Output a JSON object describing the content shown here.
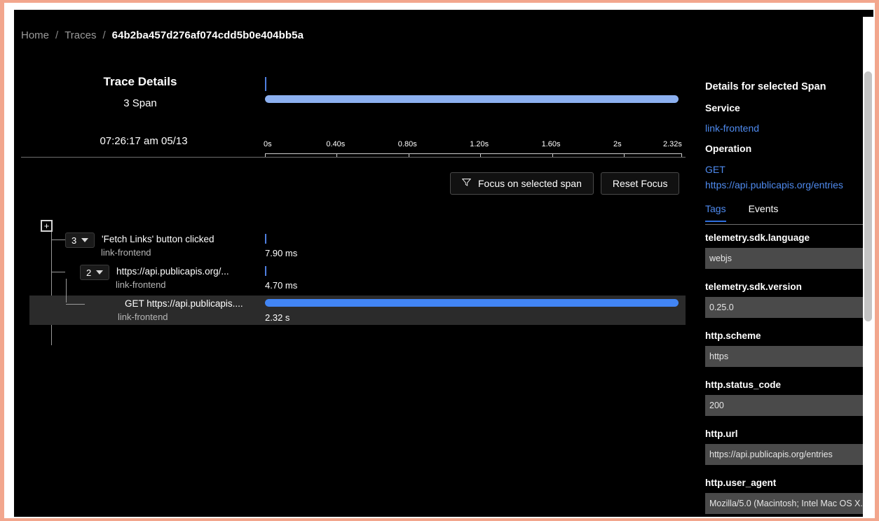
{
  "breadcrumb": {
    "home": "Home",
    "traces": "Traces",
    "separator": "/",
    "trace_id": "64b2ba457d276af074cdd5b0e404bb5a"
  },
  "trace_header": {
    "title": "Trace Details",
    "span_count": "3 Span",
    "timestamp": "07:26:17 am 05/13"
  },
  "timeline": {
    "ticks": [
      {
        "label": "0s",
        "pos": 0
      },
      {
        "label": "0.40s",
        "pos": 17.24
      },
      {
        "label": "0.80s",
        "pos": 34.48
      },
      {
        "label": "1.20s",
        "pos": 51.72
      },
      {
        "label": "1.60s",
        "pos": 68.96
      },
      {
        "label": "2s",
        "pos": 86.2
      },
      {
        "label": "2.32s",
        "pos": 100
      }
    ]
  },
  "toolbar": {
    "focus_label": "Focus on selected span",
    "reset_label": "Reset Focus",
    "funnel_icon": "funnel-icon"
  },
  "tree": {
    "expand_all_label": "+",
    "rows": [
      {
        "badge": "3",
        "name": "'Fetch Links' button clicked",
        "service": "link-frontend",
        "duration": "7.90 ms",
        "bar_type": "tick",
        "bar_start_pct": 0,
        "bar_width_pct": 0.34,
        "selected": false
      },
      {
        "badge": "2",
        "name": "https://api.publicapis.org/...",
        "service": "link-frontend",
        "duration": "4.70 ms",
        "bar_type": "tick",
        "bar_start_pct": 0,
        "bar_width_pct": 0.2,
        "selected": false
      },
      {
        "badge": "",
        "name": "GET https://api.publicapis....",
        "service": "link-frontend",
        "duration": "2.32 s",
        "bar_type": "bar",
        "bar_start_pct": 0,
        "bar_width_pct": 100,
        "selected": true
      }
    ]
  },
  "details": {
    "title": "Details for selected Span",
    "service_label": "Service",
    "service_value": "link-frontend",
    "operation_label": "Operation",
    "operation_method": "GET",
    "operation_url": "https://api.publicapis.org/entries",
    "tabs": [
      {
        "label": "Tags",
        "active": true
      },
      {
        "label": "Events",
        "active": false
      }
    ],
    "tags": [
      {
        "key": "telemetry.sdk.language",
        "value": "webjs"
      },
      {
        "key": "telemetry.sdk.version",
        "value": "0.25.0"
      },
      {
        "key": "http.scheme",
        "value": "https"
      },
      {
        "key": "http.status_code",
        "value": "200"
      },
      {
        "key": "http.url",
        "value": "https://api.publicapis.org/entries"
      },
      {
        "key": "http.user_agent",
        "value": "Mozilla/5.0 (Macintosh; Intel Mac OS X..."
      }
    ]
  },
  "colors": {
    "accent_blue": "#4285f4",
    "minimap_blue": "#8cb0f0",
    "link_blue": "#4f8bf0",
    "selected_row": "#2b2b2b",
    "tag_value_bg": "#4a4a4a",
    "frame": "#f2a68d"
  }
}
